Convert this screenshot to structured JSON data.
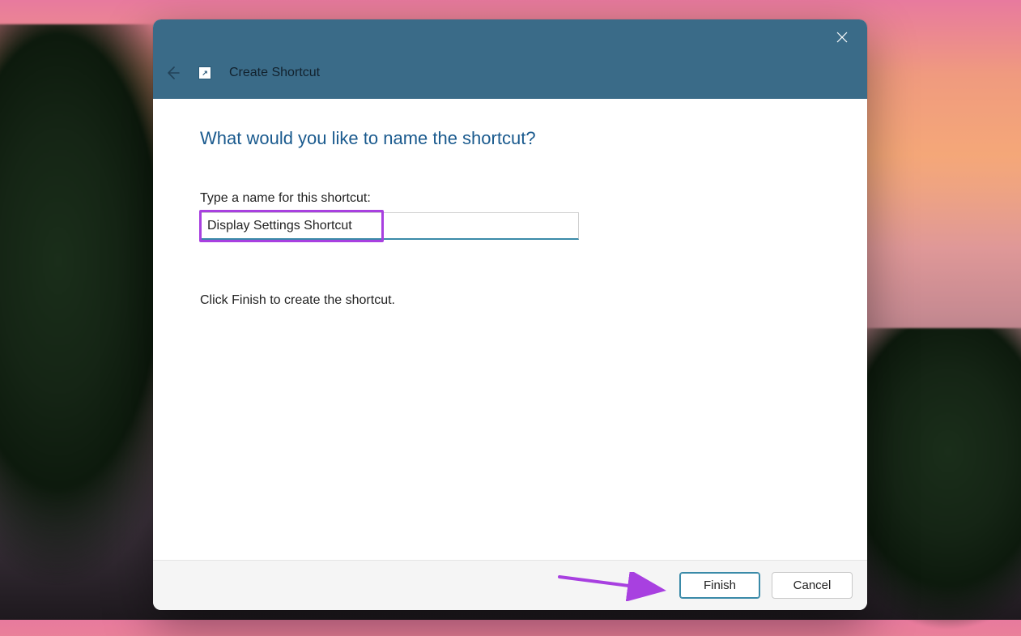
{
  "header": {
    "title": "Create Shortcut"
  },
  "body": {
    "heading": "What would you like to name the shortcut?",
    "field_label": "Type a name for this shortcut:",
    "input_value": "Display Settings Shortcut",
    "instruction": "Click Finish to create the shortcut."
  },
  "footer": {
    "finish_label": "Finish",
    "cancel_label": "Cancel"
  },
  "colors": {
    "header_bg": "#3a6b88",
    "heading_color": "#1a5a8e",
    "accent": "#3a8aa8",
    "highlight": "#a840e0"
  }
}
